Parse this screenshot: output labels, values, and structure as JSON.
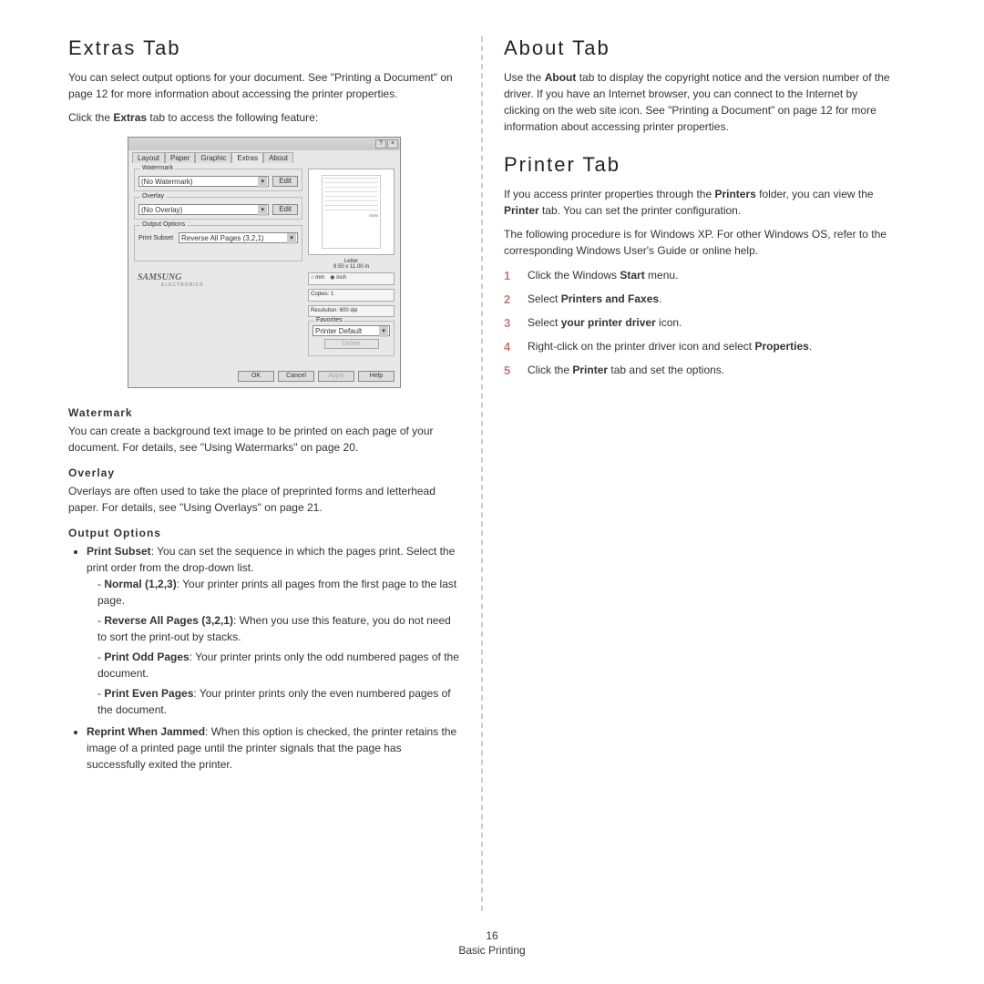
{
  "left": {
    "heading": "Extras Tab",
    "p1": "You can select output options for your document. See \"Printing a Document\" on page 12 for more information about accessing the printer properties.",
    "p2a": "Click the ",
    "p2b": "Extras",
    "p2c": " tab to access the following feature:",
    "watermark_h": "Watermark",
    "watermark_p": "You can create a background text image to be printed on each page of your document. For details, see \"Using Watermarks\" on page 20.",
    "overlay_h": "Overlay",
    "overlay_p": "Overlays are often used to take the place of preprinted forms and letterhead paper. For details, see \"Using Overlays\" on page 21.",
    "output_h": "Output Options",
    "li1a": "Print Subset",
    "li1b": ": You can set the sequence in which the pages print. Select the print order from the drop-down list.",
    "sub1a": "Normal (1,2,3)",
    "sub1b": ": Your printer prints all pages from the first page to the last page.",
    "sub2a": "Reverse All Pages (3,2,1)",
    "sub2b": ": When you use this feature, you do not need to sort the print-out by stacks.",
    "sub3a": "Print Odd Pages",
    "sub3b": ": Your printer prints only the odd numbered pages of the document.",
    "sub4a": "Print Even Pages",
    "sub4b": ": Your printer prints only the even numbered pages of the document.",
    "li2a": "Reprint When Jammed",
    "li2b": ": When this option is checked, the printer retains the image of a printed page until the printer signals that the page has successfully exited the printer."
  },
  "right": {
    "heading1": "About Tab",
    "p1a": "Use the ",
    "p1b": "About",
    "p1c": " tab to display the copyright notice and the version number of the driver. If you have an Internet browser, you can connect to the Internet by clicking on the web site icon. See \"Printing a Document\" on page 12 for more information about accessing printer properties.",
    "heading2": "Printer Tab",
    "p2a": "If you access printer properties through the ",
    "p2b": "Printers",
    "p2c": " folder, you can view the ",
    "p2d": "Printer",
    "p2e": " tab. You can set the printer configuration.",
    "p3": "The following procedure is for Windows XP. For other Windows OS, refer to the corresponding Windows User's Guide or online help.",
    "s1a": "Click the Windows ",
    "s1b": "Start",
    "s1c": " menu.",
    "s2a": "Select ",
    "s2b": "Printers and Faxes",
    "s2c": ".",
    "s3a": "Select ",
    "s3b": "your printer driver",
    "s3c": " icon.",
    "s4a": "Right-click on the printer driver icon and select ",
    "s4b": "Properties",
    "s4c": ".",
    "s5a": "Click the ",
    "s5b": "Printer",
    "s5c": " tab and set the options."
  },
  "dialog": {
    "tabs": [
      "Layout",
      "Paper",
      "Graphic",
      "Extras",
      "About"
    ],
    "watermark_legend": "Watermark",
    "watermark_val": "(No Watermark)",
    "edit": "Edit",
    "overlay_legend": "Overlay",
    "overlay_val": "(No Overlay)",
    "output_legend": "Output Options",
    "print_subset_lbl": "Print Subset",
    "print_subset_val": "Reverse All Pages (3,2,1)",
    "paper_label": "Letter",
    "paper_size": "8.50 x 11.00 in",
    "mm": "mm",
    "inch": "inch",
    "copies": "Copies: 1",
    "resolution": "Resolution: 600 dpi",
    "favorites_legend": "Favorites",
    "favorites_val": "Printer Default",
    "delete": "Delete",
    "brand": "SAMSUNG",
    "brand_sub": "ELECTRONICS",
    "ok": "OK",
    "cancel": "Cancel",
    "apply": "Apply",
    "help": "Help"
  },
  "footer": {
    "page": "16",
    "section": "Basic Printing"
  }
}
